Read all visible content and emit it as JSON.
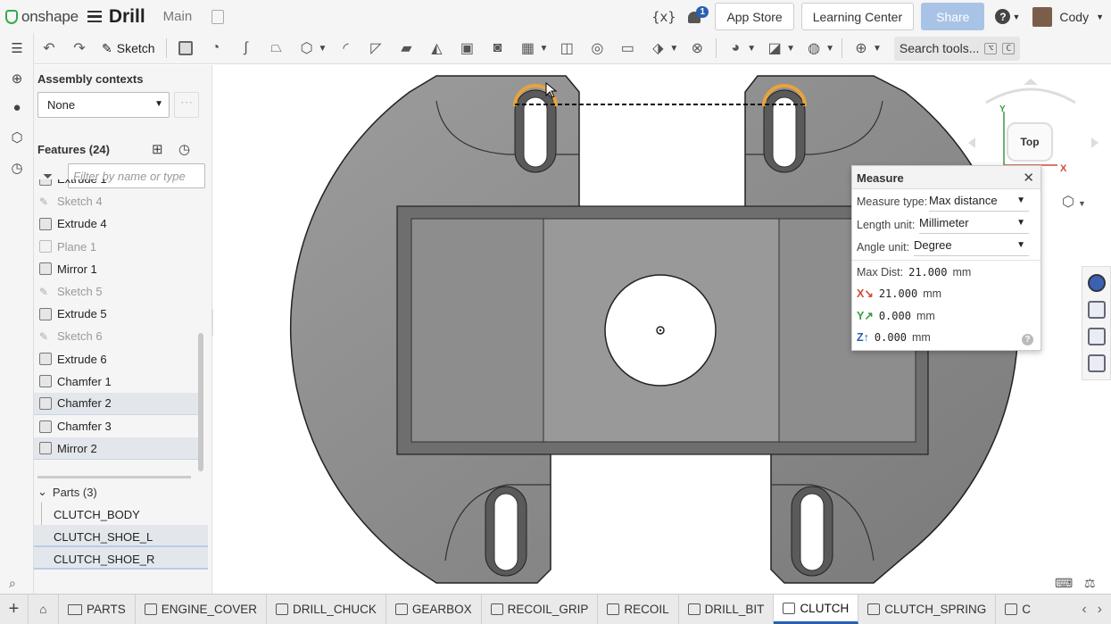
{
  "app": {
    "brand": "onshape",
    "document": "Drill",
    "workspace": "Main"
  },
  "topbar": {
    "notifications": "1",
    "app_store": "App Store",
    "learning_center": "Learning Center",
    "share": "Share",
    "help": "?",
    "user": "Cody",
    "variables_icon": "{x}"
  },
  "toolbar": {
    "sketch_label": "Sketch",
    "search_label": "Search tools...",
    "search_shortcut_1": "⌥",
    "search_shortcut_2": "C"
  },
  "panel": {
    "contexts_title": "Assembly contexts",
    "context_value": "None",
    "features_title": "Features (24)",
    "filter_placeholder": "Filter by name or type",
    "features": [
      {
        "label": "Extrude 1",
        "type": "extrude",
        "state": "normal"
      },
      {
        "label": "Sketch 4",
        "type": "sketch",
        "state": "dim"
      },
      {
        "label": "Extrude 4",
        "type": "extrude",
        "state": "normal"
      },
      {
        "label": "Plane 1",
        "type": "plane",
        "state": "dim"
      },
      {
        "label": "Mirror 1",
        "type": "mirror",
        "state": "normal"
      },
      {
        "label": "Sketch 5",
        "type": "sketch",
        "state": "dim"
      },
      {
        "label": "Extrude 5",
        "type": "extrude",
        "state": "normal"
      },
      {
        "label": "Sketch 6",
        "type": "sketch",
        "state": "dim"
      },
      {
        "label": "Extrude 6",
        "type": "extrude",
        "state": "normal"
      },
      {
        "label": "Chamfer 1",
        "type": "chamfer",
        "state": "normal"
      },
      {
        "label": "Chamfer 2",
        "type": "chamfer",
        "state": "selected"
      },
      {
        "label": "Chamfer 3",
        "type": "chamfer",
        "state": "normal"
      },
      {
        "label": "Mirror 2",
        "type": "mirror",
        "state": "selected"
      }
    ],
    "parts_title": "Parts (3)",
    "parts": [
      "CLUTCH_BODY",
      "CLUTCH_SHOE_L",
      "CLUTCH_SHOE_R"
    ]
  },
  "measure": {
    "title": "Measure",
    "type_label": "Measure type:",
    "type_value": "Max distance",
    "length_label": "Length unit:",
    "length_value": "Millimeter",
    "angle_label": "Angle unit:",
    "angle_value": "Degree",
    "max_label": "Max Dist:",
    "max_value": "21.000",
    "unit": "mm",
    "x_label": "X",
    "x_value": "21.000",
    "y_label": "Y",
    "y_value": "0.000",
    "z_label": "Z",
    "z_value": "0.000"
  },
  "viewcube": {
    "face": "Top",
    "axis_x": "X",
    "axis_y": "Y"
  },
  "tabs": {
    "folder": "PARTS",
    "items": [
      "ENGINE_COVER",
      "DRILL_CHUCK",
      "GEARBOX",
      "RECOIL_GRIP",
      "RECOIL",
      "DRILL_BIT",
      "CLUTCH",
      "CLUTCH_SPRING"
    ],
    "active": "CLUTCH",
    "overflow": "C"
  },
  "colors": {
    "accent": "#2860b0",
    "brand_green": "#35a94a",
    "part_gray": "#8a8a8a",
    "highlight": "#e8a33d"
  }
}
